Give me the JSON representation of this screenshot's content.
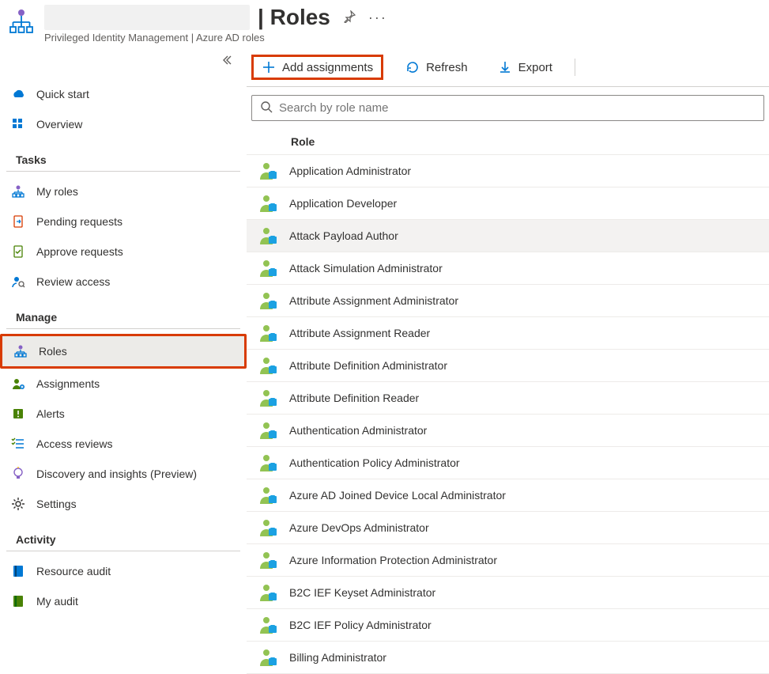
{
  "header": {
    "title_suffix": "| Roles",
    "breadcrumb": "Privileged Identity Management | Azure AD roles"
  },
  "sidebar": {
    "top": [
      {
        "icon": "cloud",
        "label": "Quick start"
      },
      {
        "icon": "grid",
        "label": "Overview"
      }
    ],
    "sections": [
      {
        "title": "Tasks",
        "items": [
          {
            "icon": "org-person",
            "label": "My roles"
          },
          {
            "icon": "clipboard-arrow",
            "label": "Pending requests"
          },
          {
            "icon": "clipboard-check",
            "label": "Approve requests"
          },
          {
            "icon": "person-search",
            "label": "Review access"
          }
        ]
      },
      {
        "title": "Manage",
        "items": [
          {
            "icon": "org",
            "label": "Roles",
            "selected": true,
            "highlight": true
          },
          {
            "icon": "person-plus",
            "label": "Assignments"
          },
          {
            "icon": "alert",
            "label": "Alerts"
          },
          {
            "icon": "checklist",
            "label": "Access reviews"
          },
          {
            "icon": "bulb",
            "label": "Discovery and insights (Preview)"
          },
          {
            "icon": "gear",
            "label": "Settings"
          }
        ]
      },
      {
        "title": "Activity",
        "items": [
          {
            "icon": "book-blue",
            "label": "Resource audit"
          },
          {
            "icon": "book-green",
            "label": "My audit"
          }
        ]
      }
    ]
  },
  "toolbar": {
    "add": "Add assignments",
    "refresh": "Refresh",
    "export": "Export"
  },
  "search": {
    "placeholder": "Search by role name"
  },
  "table": {
    "column": "Role",
    "rows": [
      "Application Administrator",
      "Application Developer",
      "Attack Payload Author",
      "Attack Simulation Administrator",
      "Attribute Assignment Administrator",
      "Attribute Assignment Reader",
      "Attribute Definition Administrator",
      "Attribute Definition Reader",
      "Authentication Administrator",
      "Authentication Policy Administrator",
      "Azure AD Joined Device Local Administrator",
      "Azure DevOps Administrator",
      "Azure Information Protection Administrator",
      "B2C IEF Keyset Administrator",
      "B2C IEF Policy Administrator",
      "Billing Administrator"
    ],
    "hover_index": 2
  }
}
